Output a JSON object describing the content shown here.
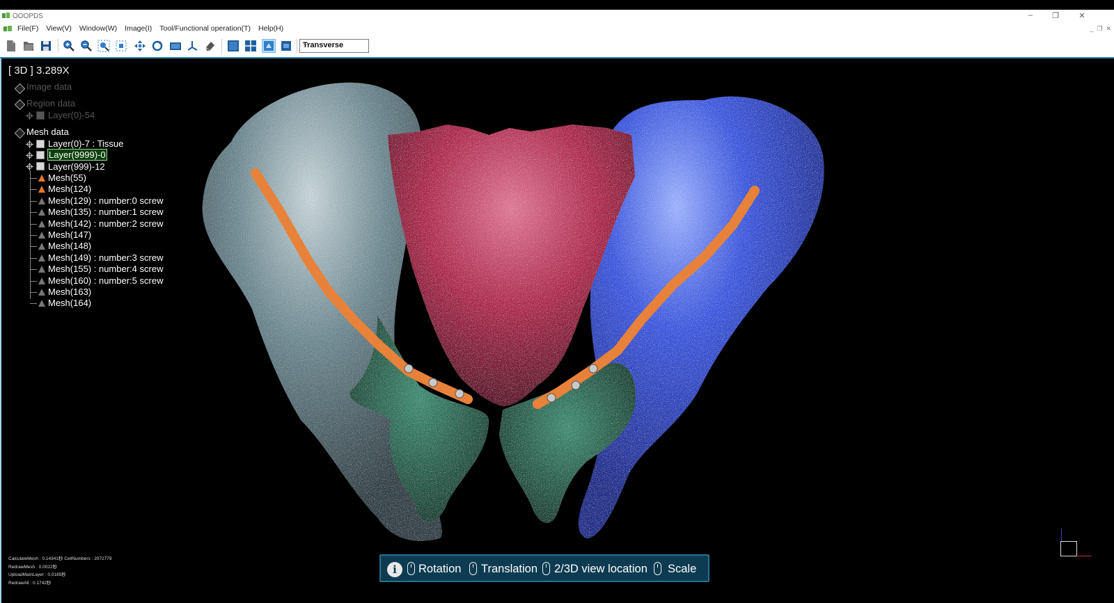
{
  "window": {
    "title": "OOOPDS",
    "minimize": "–",
    "restore": "❐",
    "close": "✕"
  },
  "menu": {
    "items": [
      "File(F)",
      "View(V)",
      "Window(W)",
      "Image(I)",
      "Tool/Functional operation(T)",
      "Help(H)"
    ],
    "mdi_controls": [
      "_",
      "❐",
      "✕"
    ]
  },
  "toolbar": {
    "buttons": [
      {
        "name": "new-file-icon"
      },
      {
        "name": "open-file-icon"
      },
      {
        "name": "save-icon"
      },
      {
        "name": "zoom-in-icon"
      },
      {
        "name": "zoom-out-icon"
      },
      {
        "name": "zoom-fit-icon"
      },
      {
        "name": "zoom-region-icon"
      },
      {
        "name": "pan-icon"
      },
      {
        "name": "rotate-icon"
      },
      {
        "name": "screenshot-icon"
      },
      {
        "name": "axis-icon"
      },
      {
        "name": "eraser-icon"
      },
      {
        "name": "layout-single-icon"
      },
      {
        "name": "layout-quad-icon"
      },
      {
        "name": "view-3d-icon"
      },
      {
        "name": "view-2d-icon"
      }
    ],
    "active_button": "view-3d-icon",
    "view_select": {
      "value": "Transverse"
    }
  },
  "viewport": {
    "zoom_label": "[ 3D ] 3.289X",
    "tree": {
      "image_data": "Image data",
      "region_data": "Region data",
      "region_layer": "Layer(0)-54",
      "mesh_data": "Mesh data",
      "layers": [
        "Layer(0)-7 : Tissue",
        "Layer(9999)-0",
        "Layer(999)-12"
      ],
      "selected_layer": "Layer(9999)-0",
      "meshes": [
        {
          "label": "Mesh(55)",
          "color": "orange"
        },
        {
          "label": "Mesh(124)",
          "color": "orange"
        },
        {
          "label": "Mesh(129) : number:0 screw",
          "color": "gray"
        },
        {
          "label": "Mesh(135) : number:1 screw",
          "color": "gray"
        },
        {
          "label": "Mesh(142) : number:2 screw",
          "color": "gray"
        },
        {
          "label": "Mesh(147)",
          "color": "gray"
        },
        {
          "label": "Mesh(148)",
          "color": "gray"
        },
        {
          "label": "Mesh(149) : number:3 screw",
          "color": "gray"
        },
        {
          "label": "Mesh(155) : number:4 screw",
          "color": "gray"
        },
        {
          "label": "Mesh(160) : number:5 screw",
          "color": "gray"
        },
        {
          "label": "Mesh(163)",
          "color": "gray"
        },
        {
          "label": "Mesh(164)",
          "color": "gray"
        }
      ]
    },
    "stats": [
      "CalculateMesh : 0.14341秒 CellNumbers : 2072779",
      "RedrawMesh : 0.0022秒",
      "UploadMainLayer : 0.0185秒",
      "RedrawAll : 0.1742秒"
    ],
    "help_bar": {
      "rotation": "Rotation",
      "translation": "Translation",
      "view_location": "2/3D view location",
      "scale": "Scale"
    }
  },
  "colors": {
    "left_hip": "#6f8a93",
    "right_hip": "#3a58e0",
    "sacrum": "#b0254e",
    "fracture": "#1a5c47",
    "plate": "#e8823a",
    "accent": "#2c8bb0"
  }
}
